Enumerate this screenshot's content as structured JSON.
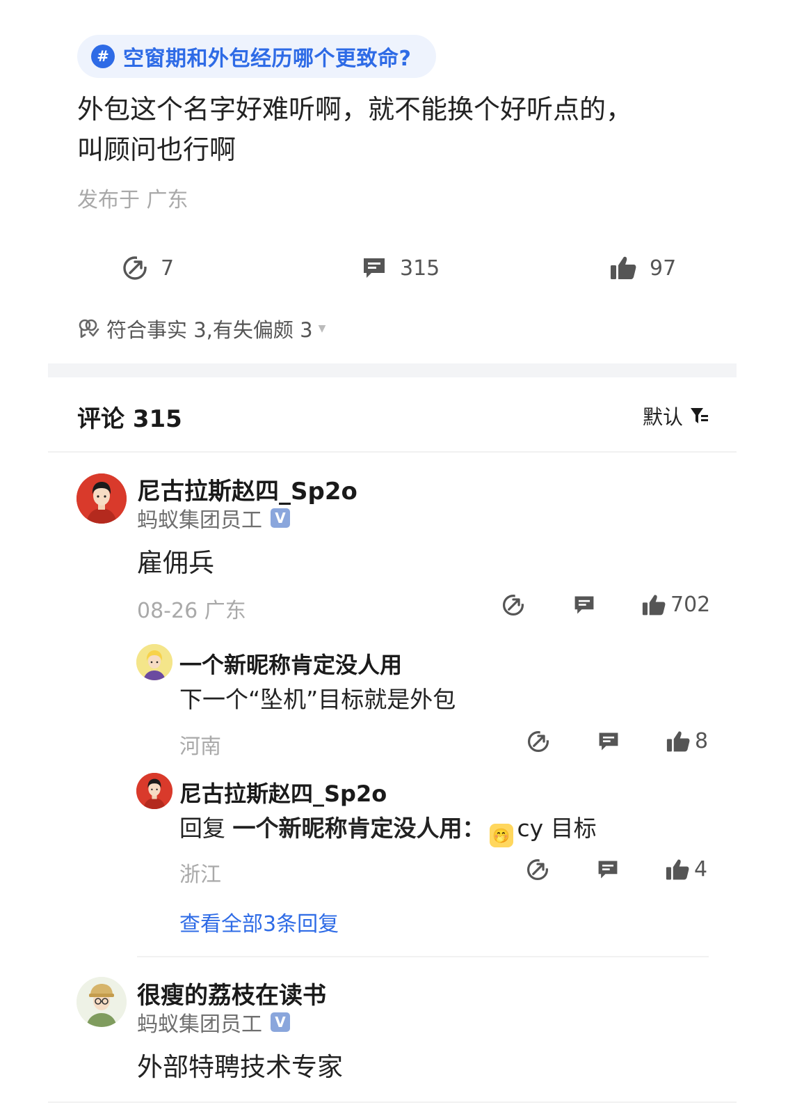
{
  "topic": {
    "label": "空窗期和外包经历哪个更致命?"
  },
  "post": {
    "line1": "外包这个名字好难听啊，就不能换个好听点的，",
    "line2": "叫顾问也行啊",
    "location": "发布于 广东",
    "share_count": "7",
    "comment_count": "315",
    "like_count": "97",
    "fact_check": "符合事实 3,有失偏颇 3"
  },
  "comments_header": {
    "title": "评论 315",
    "sort_label": "默认"
  },
  "comments": [
    {
      "author": "尼古拉斯赵四_Sp2o",
      "company": "蚂蚁集团员工",
      "badge": "V",
      "text": "雇佣兵",
      "meta": "08-26 广东",
      "likes": "702",
      "replies": [
        {
          "author": "一个新昵称肯定没人用",
          "text": "下一个“坠机”目标就是外包",
          "location": "河南",
          "likes": "8"
        },
        {
          "author": "尼古拉斯赵四_Sp2o",
          "reply_prefix": "回复 ",
          "reply_target": "一个新昵称肯定没人用：",
          "reply_suffix": "cy 目标",
          "location": "浙江",
          "likes": "4"
        }
      ],
      "view_all": "查看全部3条回复"
    },
    {
      "author": "很瘦的荔枝在读书",
      "company": "蚂蚁集团员工",
      "badge": "V",
      "text": "外部特聘技术专家"
    }
  ],
  "colors": {
    "accent": "#2e6be6",
    "muted": "#a9a9a9",
    "chip_bg": "#eef3fd"
  }
}
